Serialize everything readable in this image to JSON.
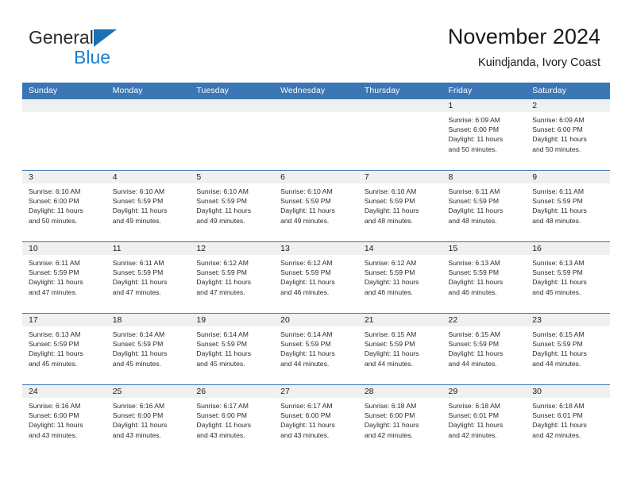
{
  "brand": {
    "name_part1": "General",
    "name_part2": "Blue",
    "flag_color": "#1a6fb5",
    "text_color": "#2b2b2b",
    "blue_color": "#1a7fd4"
  },
  "header": {
    "title": "November 2024",
    "subtitle": "Kuindjanda, Ivory Coast"
  },
  "theme": {
    "header_bar_color": "#3b76b5",
    "day_band_color": "#f0f0f0",
    "grid_line_color": "#3b76b5"
  },
  "weekdays": [
    "Sunday",
    "Monday",
    "Tuesday",
    "Wednesday",
    "Thursday",
    "Friday",
    "Saturday"
  ],
  "weeks": [
    [
      {
        "day": "",
        "lines": []
      },
      {
        "day": "",
        "lines": []
      },
      {
        "day": "",
        "lines": []
      },
      {
        "day": "",
        "lines": []
      },
      {
        "day": "",
        "lines": []
      },
      {
        "day": "1",
        "lines": [
          "Sunrise: 6:09 AM",
          "Sunset: 6:00 PM",
          "Daylight: 11 hours",
          "and 50 minutes."
        ]
      },
      {
        "day": "2",
        "lines": [
          "Sunrise: 6:09 AM",
          "Sunset: 6:00 PM",
          "Daylight: 11 hours",
          "and 50 minutes."
        ]
      }
    ],
    [
      {
        "day": "3",
        "lines": [
          "Sunrise: 6:10 AM",
          "Sunset: 6:00 PM",
          "Daylight: 11 hours",
          "and 50 minutes."
        ]
      },
      {
        "day": "4",
        "lines": [
          "Sunrise: 6:10 AM",
          "Sunset: 5:59 PM",
          "Daylight: 11 hours",
          "and 49 minutes."
        ]
      },
      {
        "day": "5",
        "lines": [
          "Sunrise: 6:10 AM",
          "Sunset: 5:59 PM",
          "Daylight: 11 hours",
          "and 49 minutes."
        ]
      },
      {
        "day": "6",
        "lines": [
          "Sunrise: 6:10 AM",
          "Sunset: 5:59 PM",
          "Daylight: 11 hours",
          "and 49 minutes."
        ]
      },
      {
        "day": "7",
        "lines": [
          "Sunrise: 6:10 AM",
          "Sunset: 5:59 PM",
          "Daylight: 11 hours",
          "and 48 minutes."
        ]
      },
      {
        "day": "8",
        "lines": [
          "Sunrise: 6:11 AM",
          "Sunset: 5:59 PM",
          "Daylight: 11 hours",
          "and 48 minutes."
        ]
      },
      {
        "day": "9",
        "lines": [
          "Sunrise: 6:11 AM",
          "Sunset: 5:59 PM",
          "Daylight: 11 hours",
          "and 48 minutes."
        ]
      }
    ],
    [
      {
        "day": "10",
        "lines": [
          "Sunrise: 6:11 AM",
          "Sunset: 5:59 PM",
          "Daylight: 11 hours",
          "and 47 minutes."
        ]
      },
      {
        "day": "11",
        "lines": [
          "Sunrise: 6:11 AM",
          "Sunset: 5:59 PM",
          "Daylight: 11 hours",
          "and 47 minutes."
        ]
      },
      {
        "day": "12",
        "lines": [
          "Sunrise: 6:12 AM",
          "Sunset: 5:59 PM",
          "Daylight: 11 hours",
          "and 47 minutes."
        ]
      },
      {
        "day": "13",
        "lines": [
          "Sunrise: 6:12 AM",
          "Sunset: 5:59 PM",
          "Daylight: 11 hours",
          "and 46 minutes."
        ]
      },
      {
        "day": "14",
        "lines": [
          "Sunrise: 6:12 AM",
          "Sunset: 5:59 PM",
          "Daylight: 11 hours",
          "and 46 minutes."
        ]
      },
      {
        "day": "15",
        "lines": [
          "Sunrise: 6:13 AM",
          "Sunset: 5:59 PM",
          "Daylight: 11 hours",
          "and 46 minutes."
        ]
      },
      {
        "day": "16",
        "lines": [
          "Sunrise: 6:13 AM",
          "Sunset: 5:59 PM",
          "Daylight: 11 hours",
          "and 45 minutes."
        ]
      }
    ],
    [
      {
        "day": "17",
        "lines": [
          "Sunrise: 6:13 AM",
          "Sunset: 5:59 PM",
          "Daylight: 11 hours",
          "and 45 minutes."
        ]
      },
      {
        "day": "18",
        "lines": [
          "Sunrise: 6:14 AM",
          "Sunset: 5:59 PM",
          "Daylight: 11 hours",
          "and 45 minutes."
        ]
      },
      {
        "day": "19",
        "lines": [
          "Sunrise: 6:14 AM",
          "Sunset: 5:59 PM",
          "Daylight: 11 hours",
          "and 45 minutes."
        ]
      },
      {
        "day": "20",
        "lines": [
          "Sunrise: 6:14 AM",
          "Sunset: 5:59 PM",
          "Daylight: 11 hours",
          "and 44 minutes."
        ]
      },
      {
        "day": "21",
        "lines": [
          "Sunrise: 6:15 AM",
          "Sunset: 5:59 PM",
          "Daylight: 11 hours",
          "and 44 minutes."
        ]
      },
      {
        "day": "22",
        "lines": [
          "Sunrise: 6:15 AM",
          "Sunset: 5:59 PM",
          "Daylight: 11 hours",
          "and 44 minutes."
        ]
      },
      {
        "day": "23",
        "lines": [
          "Sunrise: 6:15 AM",
          "Sunset: 5:59 PM",
          "Daylight: 11 hours",
          "and 44 minutes."
        ]
      }
    ],
    [
      {
        "day": "24",
        "lines": [
          "Sunrise: 6:16 AM",
          "Sunset: 6:00 PM",
          "Daylight: 11 hours",
          "and 43 minutes."
        ]
      },
      {
        "day": "25",
        "lines": [
          "Sunrise: 6:16 AM",
          "Sunset: 6:00 PM",
          "Daylight: 11 hours",
          "and 43 minutes."
        ]
      },
      {
        "day": "26",
        "lines": [
          "Sunrise: 6:17 AM",
          "Sunset: 6:00 PM",
          "Daylight: 11 hours",
          "and 43 minutes."
        ]
      },
      {
        "day": "27",
        "lines": [
          "Sunrise: 6:17 AM",
          "Sunset: 6:00 PM",
          "Daylight: 11 hours",
          "and 43 minutes."
        ]
      },
      {
        "day": "28",
        "lines": [
          "Sunrise: 6:18 AM",
          "Sunset: 6:00 PM",
          "Daylight: 11 hours",
          "and 42 minutes."
        ]
      },
      {
        "day": "29",
        "lines": [
          "Sunrise: 6:18 AM",
          "Sunset: 6:01 PM",
          "Daylight: 11 hours",
          "and 42 minutes."
        ]
      },
      {
        "day": "30",
        "lines": [
          "Sunrise: 6:18 AM",
          "Sunset: 6:01 PM",
          "Daylight: 11 hours",
          "and 42 minutes."
        ]
      }
    ]
  ]
}
